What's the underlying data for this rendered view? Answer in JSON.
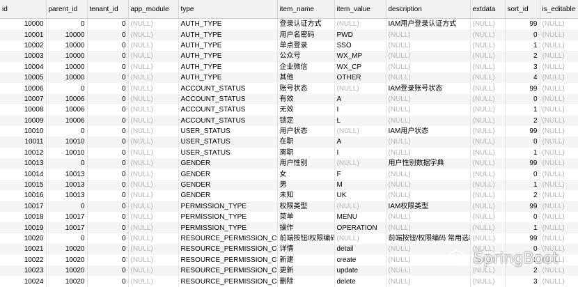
{
  "columns": [
    "id",
    "parent_id",
    "tenant_id",
    "app_module",
    "type",
    "item_name",
    "item_value",
    "description",
    "extdata",
    "sort_id",
    "is_editable"
  ],
  "null_text": "(NULL)",
  "rows": [
    [
      "10000",
      "0",
      "0",
      null,
      "AUTH_TYPE",
      "登录认证方式",
      null,
      "IAM用户登录认证方式",
      null,
      "99",
      null
    ],
    [
      "10001",
      "10000",
      "0",
      null,
      "AUTH_TYPE",
      "用户名密码",
      "PWD",
      null,
      null,
      "0",
      null
    ],
    [
      "10002",
      "10000",
      "0",
      null,
      "AUTH_TYPE",
      "单点登录",
      "SSO",
      null,
      null,
      "1",
      null
    ],
    [
      "10003",
      "10000",
      "0",
      null,
      "AUTH_TYPE",
      "公众号",
      "WX_MP",
      null,
      null,
      "2",
      null
    ],
    [
      "10004",
      "10000",
      "0",
      null,
      "AUTH_TYPE",
      "企业微信",
      "WX_CP",
      null,
      null,
      "3",
      null
    ],
    [
      "10005",
      "10000",
      "0",
      null,
      "AUTH_TYPE",
      "其他",
      "OTHER",
      null,
      null,
      "4",
      null
    ],
    [
      "10006",
      "0",
      "0",
      null,
      "ACCOUNT_STATUS",
      "账号状态",
      null,
      "IAM登录账号状态",
      null,
      "99",
      null
    ],
    [
      "10007",
      "10006",
      "0",
      null,
      "ACCOUNT_STATUS",
      "有效",
      "A",
      null,
      null,
      "0",
      null
    ],
    [
      "10008",
      "10006",
      "0",
      null,
      "ACCOUNT_STATUS",
      "无效",
      "I",
      null,
      null,
      "1",
      null
    ],
    [
      "10009",
      "10006",
      "0",
      null,
      "ACCOUNT_STATUS",
      "锁定",
      "L",
      null,
      null,
      "2",
      null
    ],
    [
      "10010",
      "0",
      "0",
      null,
      "USER_STATUS",
      "用户状态",
      null,
      "IAM用户状态",
      null,
      "99",
      null
    ],
    [
      "10011",
      "10010",
      "0",
      null,
      "USER_STATUS",
      "在职",
      "A",
      null,
      null,
      "0",
      null
    ],
    [
      "10012",
      "10010",
      "0",
      null,
      "USER_STATUS",
      "离职",
      "I",
      null,
      null,
      "1",
      null
    ],
    [
      "10013",
      "0",
      "0",
      null,
      "GENDER",
      "用户性别",
      null,
      "用户性别数据字典",
      null,
      "99",
      null
    ],
    [
      "10014",
      "10013",
      "0",
      null,
      "GENDER",
      "女",
      "F",
      null,
      null,
      "0",
      null
    ],
    [
      "10015",
      "10013",
      "0",
      null,
      "GENDER",
      "男",
      "M",
      null,
      null,
      "1",
      null
    ],
    [
      "10016",
      "10013",
      "0",
      null,
      "GENDER",
      "未知",
      "UK",
      null,
      null,
      "2",
      null
    ],
    [
      "10017",
      "0",
      "0",
      null,
      "PERMISSION_TYPE",
      "权限类型",
      null,
      "IAM权限类型",
      null,
      "99",
      null
    ],
    [
      "10018",
      "10017",
      "0",
      null,
      "PERMISSION_TYPE",
      "菜单",
      "MENU",
      null,
      null,
      "0",
      null
    ],
    [
      "10019",
      "10017",
      "0",
      null,
      "PERMISSION_TYPE",
      "操作",
      "OPERATION",
      null,
      null,
      "1",
      null
    ],
    [
      "10020",
      "0",
      "0",
      null,
      "RESOURCE_PERMISSION_CODE",
      "前端按钮/权限编码",
      null,
      "前端按钮/权限编码 常用选项",
      null,
      "99",
      null
    ],
    [
      "10021",
      "10020",
      "0",
      null,
      "RESOURCE_PERMISSION_CODE",
      "详情",
      "detail",
      null,
      null,
      "0",
      null
    ],
    [
      "10022",
      "10020",
      "0",
      null,
      "RESOURCE_PERMISSION_CODE",
      "新建",
      "create",
      null,
      null,
      "1",
      null
    ],
    [
      "10023",
      "10020",
      "0",
      null,
      "RESOURCE_PERMISSION_CODE",
      "更新",
      "update",
      null,
      null,
      "2",
      null
    ],
    [
      "10024",
      "10020",
      "0",
      null,
      "RESOURCE_PERMISSION_CODE",
      "删除",
      "delete",
      null,
      null,
      "3",
      null
    ]
  ],
  "watermark": {
    "text": "SpringBoot",
    "icon": "wechat-icon"
  }
}
